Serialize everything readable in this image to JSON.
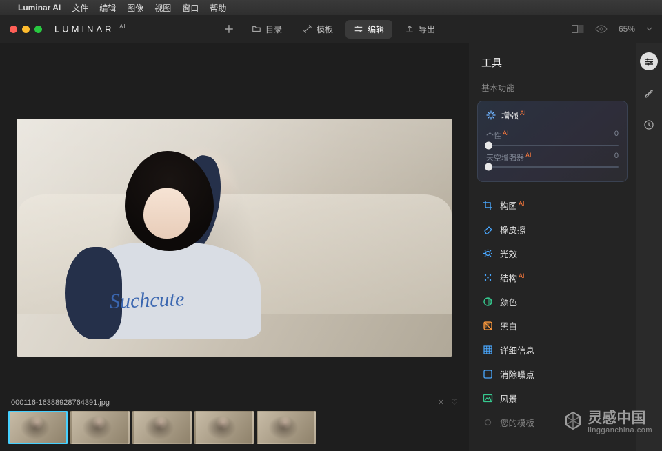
{
  "menubar": {
    "app": "Luminar AI",
    "items": [
      "文件",
      "编辑",
      "图像",
      "视图",
      "窗口",
      "帮助"
    ]
  },
  "logo": {
    "text": "LUMINAR",
    "suffix": "AI"
  },
  "topnav": {
    "add": "",
    "catalog": "目录",
    "templates": "模板",
    "edit": "编辑",
    "export": "导出"
  },
  "topright": {
    "zoom": "65%"
  },
  "canvas": {
    "shirtScript": "Suchcute"
  },
  "filebar": {
    "filename": "000116-16388928764391.jpg"
  },
  "panel": {
    "title": "工具",
    "section_basic": "基本功能",
    "enhance": {
      "label": "增强",
      "sliders": [
        {
          "label": "个性",
          "value": "0"
        },
        {
          "label": "天空增强器",
          "value": "0"
        }
      ]
    },
    "tools": [
      {
        "key": "composition",
        "label": "构图",
        "ai": true,
        "color": "#4aa8ff"
      },
      {
        "key": "eraser",
        "label": "橡皮擦",
        "ai": false,
        "color": "#4aa8ff"
      },
      {
        "key": "light",
        "label": "光效",
        "ai": false,
        "color": "#4aa8ff"
      },
      {
        "key": "structure",
        "label": "结构",
        "ai": true,
        "color": "#4aa8ff"
      },
      {
        "key": "color",
        "label": "颜色",
        "ai": false,
        "color": "#36c98f"
      },
      {
        "key": "bw",
        "label": "黑白",
        "ai": false,
        "color": "#ff9a3c"
      },
      {
        "key": "detail",
        "label": "详细信息",
        "ai": false,
        "color": "#4aa8ff"
      },
      {
        "key": "denoise",
        "label": "消除噪点",
        "ai": false,
        "color": "#4aa8ff"
      },
      {
        "key": "landscape",
        "label": "风景",
        "ai": false,
        "color": "#36c98f"
      }
    ],
    "templates_label": "您的模板"
  },
  "watermark": {
    "text": "灵感中国",
    "sub": "lingganchina.com"
  }
}
